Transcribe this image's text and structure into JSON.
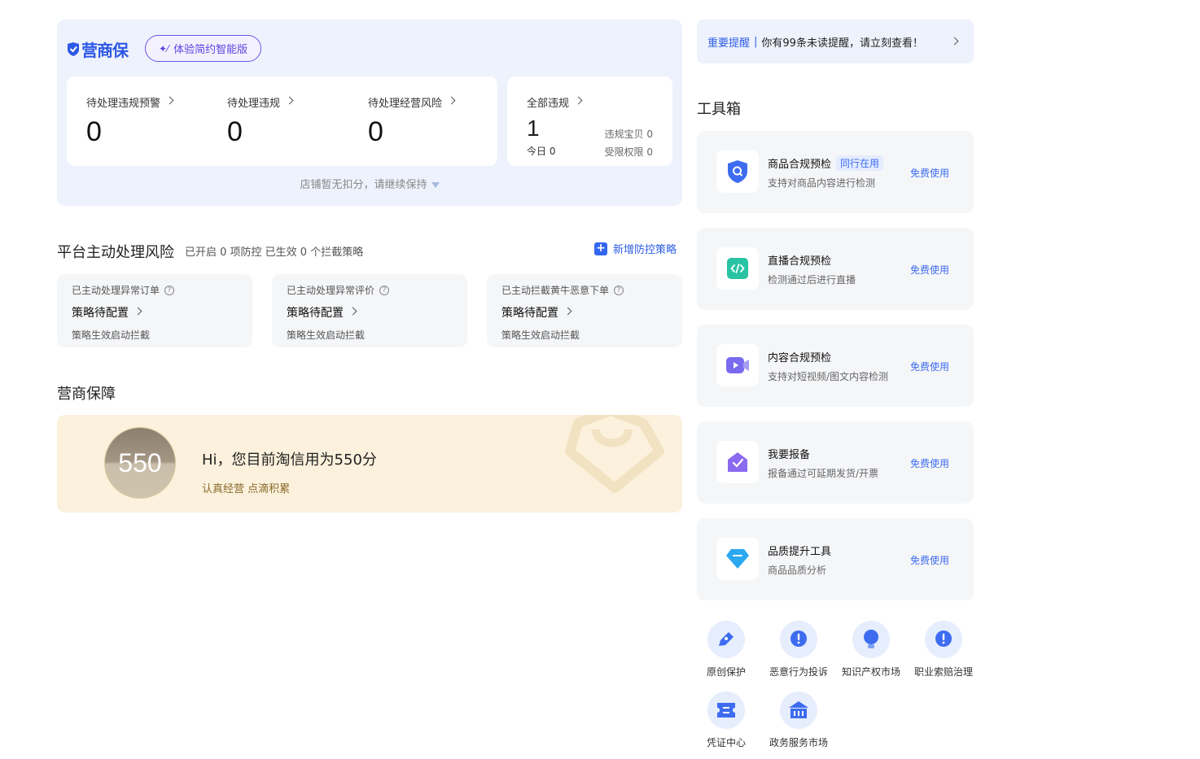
{
  "brand": {
    "name": "营商保",
    "upgrade_btn": "体验简约智能版"
  },
  "pending_stats": [
    {
      "label": "待处理违规预警",
      "value": "0"
    },
    {
      "label": "待处理违规",
      "value": "0"
    },
    {
      "label": "待处理经营风险",
      "value": "0"
    }
  ],
  "all_violations": {
    "label": "全部违规",
    "value": "1",
    "today": "今日 0",
    "items_violations": "违规宝贝 0",
    "restricted": "受限权限 0"
  },
  "deduction_note": "店铺暂无扣分，请继续保持",
  "risk": {
    "title": "平台主动处理风险",
    "subtitle": "已开启 0 项防控 已生效 0 个拦截策略",
    "add_policy": "新增防控策略",
    "cards": [
      {
        "title": "已主动处理异常订单",
        "status": "策略待配置",
        "desc": "策略生效启动拦截"
      },
      {
        "title": "已主动处理异常评价",
        "status": "策略待配置",
        "desc": "策略生效启动拦截"
      },
      {
        "title": "已主动拦截黄牛恶意下单",
        "status": "策略待配置",
        "desc": "策略生效启动拦截"
      }
    ]
  },
  "guarantee": {
    "title": "营商保障",
    "score": "550",
    "greeting": "Hi，您目前淘信用为550分",
    "slogan": "认真经营 点滴积累"
  },
  "notice": {
    "important": "重要提醒",
    "separator": "|",
    "message": "你有99条未读提醒，请立刻查看！"
  },
  "toolbox": {
    "title": "工具箱",
    "tools": [
      {
        "name": "商品合规预检",
        "tag": "同行在用",
        "desc": "支持对商品内容进行检测",
        "link": "免费使用",
        "icon": "shield-search-icon",
        "color": "#3d6cf0"
      },
      {
        "name": "直播合规预检",
        "tag": "",
        "desc": "检测通过后进行直播",
        "link": "免费使用",
        "icon": "code-icon",
        "color": "#28c3a3"
      },
      {
        "name": "内容合规预检",
        "tag": "",
        "desc": "支持对短视频/图文内容检测",
        "link": "免费使用",
        "icon": "video-icon",
        "color": "#7a6af0"
      },
      {
        "name": "我要报备",
        "tag": "",
        "desc": "报备通过可延期发货/开票",
        "link": "免费使用",
        "icon": "mail-check-icon",
        "color": "#8a6af0"
      },
      {
        "name": "品质提升工具",
        "tag": "",
        "desc": "商品品质分析",
        "link": "免费使用",
        "icon": "diamond-icon",
        "color": "#2ba8ef"
      }
    ]
  },
  "shortcuts": [
    {
      "label": "原创保护",
      "icon": "pen-icon"
    },
    {
      "label": "恶意行为投诉",
      "icon": "alert-bubble-icon"
    },
    {
      "label": "知识产权市场",
      "icon": "bulb-icon"
    },
    {
      "label": "职业索赔治理",
      "icon": "alert-bubble-icon"
    },
    {
      "label": "凭证中心",
      "icon": "ticket-icon"
    },
    {
      "label": "政务服务市场",
      "icon": "building-icon"
    }
  ]
}
